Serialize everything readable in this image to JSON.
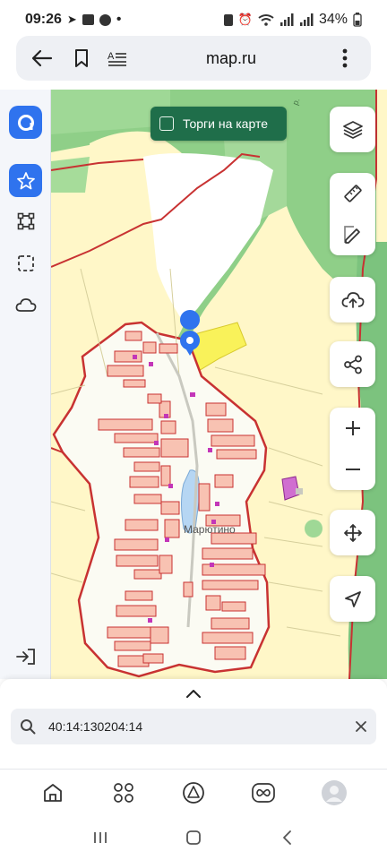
{
  "status_bar": {
    "time": "09:26",
    "battery": "34%",
    "dot": "•"
  },
  "browser": {
    "url": "map.ru"
  },
  "map": {
    "torgi_label": "Торги на карте",
    "village_label": "Марютино",
    "road_label": "р."
  },
  "search": {
    "value": "40:14:130204:14",
    "placeholder": ""
  },
  "icons": {
    "left_bar": [
      "logo-icon",
      "star-icon",
      "polygon-icon",
      "select-area-icon",
      "cloud-icon",
      "login-icon"
    ],
    "right_bar": [
      "layers-icon",
      "ruler-icon",
      "pencil-icon",
      "upload-cloud-icon",
      "share-icon",
      "zoom-in-icon",
      "zoom-out-icon",
      "move-icon",
      "locate-icon"
    ],
    "bottom_nav": [
      "home-icon",
      "apps-icon",
      "assistant-icon",
      "infinity-icon",
      "avatar"
    ]
  },
  "colors": {
    "accent": "#2f73ee",
    "torgi_bg": "#1f6e4a",
    "forest": "#7cc37e",
    "field": "#fff7c8",
    "boundary": "#c83232"
  }
}
